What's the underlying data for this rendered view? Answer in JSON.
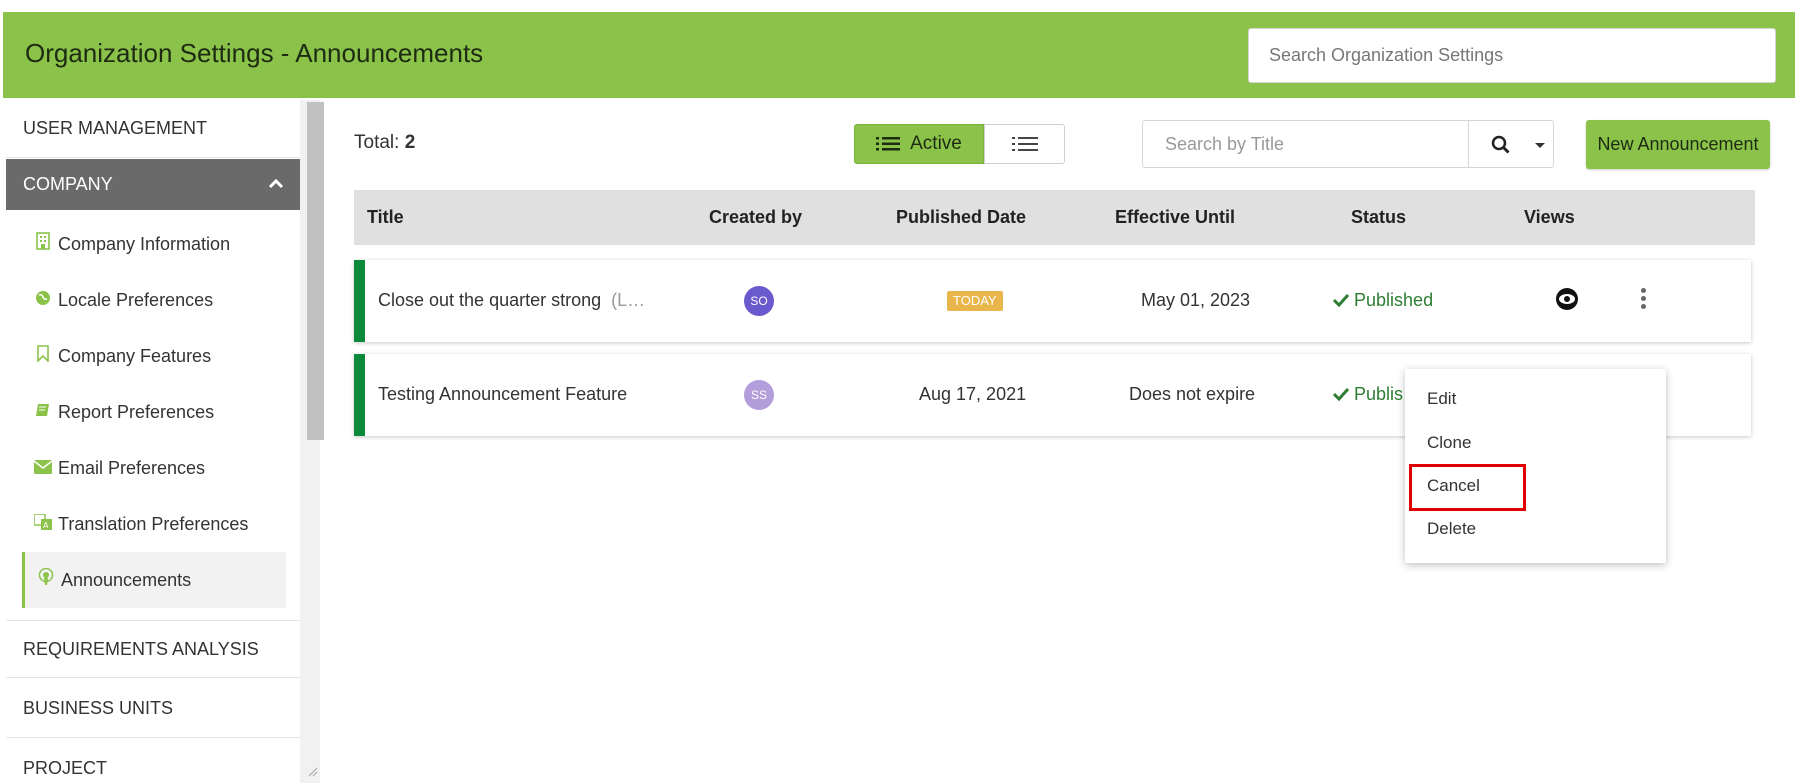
{
  "header": {
    "title": "Organization Settings - Announcements",
    "search_placeholder": "Search Organization Settings"
  },
  "sidebar": {
    "sections": {
      "user_management": "USER MANAGEMENT",
      "company": "COMPANY",
      "requirements_analysis": "REQUIREMENTS ANALYSIS",
      "business_units": "BUSINESS UNITS",
      "project": "PROJECT"
    },
    "items": [
      {
        "label": "Company Information",
        "icon": "building-icon"
      },
      {
        "label": "Locale Preferences",
        "icon": "globe-icon"
      },
      {
        "label": "Company Features",
        "icon": "bookmark-icon"
      },
      {
        "label": "Report Preferences",
        "icon": "book-icon"
      },
      {
        "label": "Email Preferences",
        "icon": "envelope-icon"
      },
      {
        "label": "Translation Preferences",
        "icon": "translate-icon"
      },
      {
        "label": "Announcements",
        "icon": "podcast-icon",
        "active": true
      }
    ]
  },
  "toolbar": {
    "total_label": "Total:",
    "total_value": "2",
    "active_label": "Active",
    "search_placeholder": "Search by Title",
    "new_button": "New Announcement"
  },
  "table": {
    "columns": [
      "Title",
      "Created by",
      "Published Date",
      "Effective Until",
      "Status",
      "Views"
    ],
    "rows": [
      {
        "title": "Close out the quarter strong",
        "title_suffix": "(L…",
        "creator": "SO",
        "creator_color": "#6a5acd",
        "published": "TODAY",
        "effective_until": "May 01, 2023",
        "status": "Published"
      },
      {
        "title": "Testing Announcement Feature",
        "creator": "SS",
        "creator_color": "#b39ddb",
        "published": "Aug 17, 2021",
        "effective_until": "Does not expire",
        "status": "Publis"
      }
    ]
  },
  "menu": {
    "items": [
      "Edit",
      "Clone",
      "Cancel",
      "Delete"
    ]
  },
  "colors": {
    "brand_green": "#8bc34a",
    "row_accent": "#0b8a3a",
    "highlight": "#e00000"
  }
}
